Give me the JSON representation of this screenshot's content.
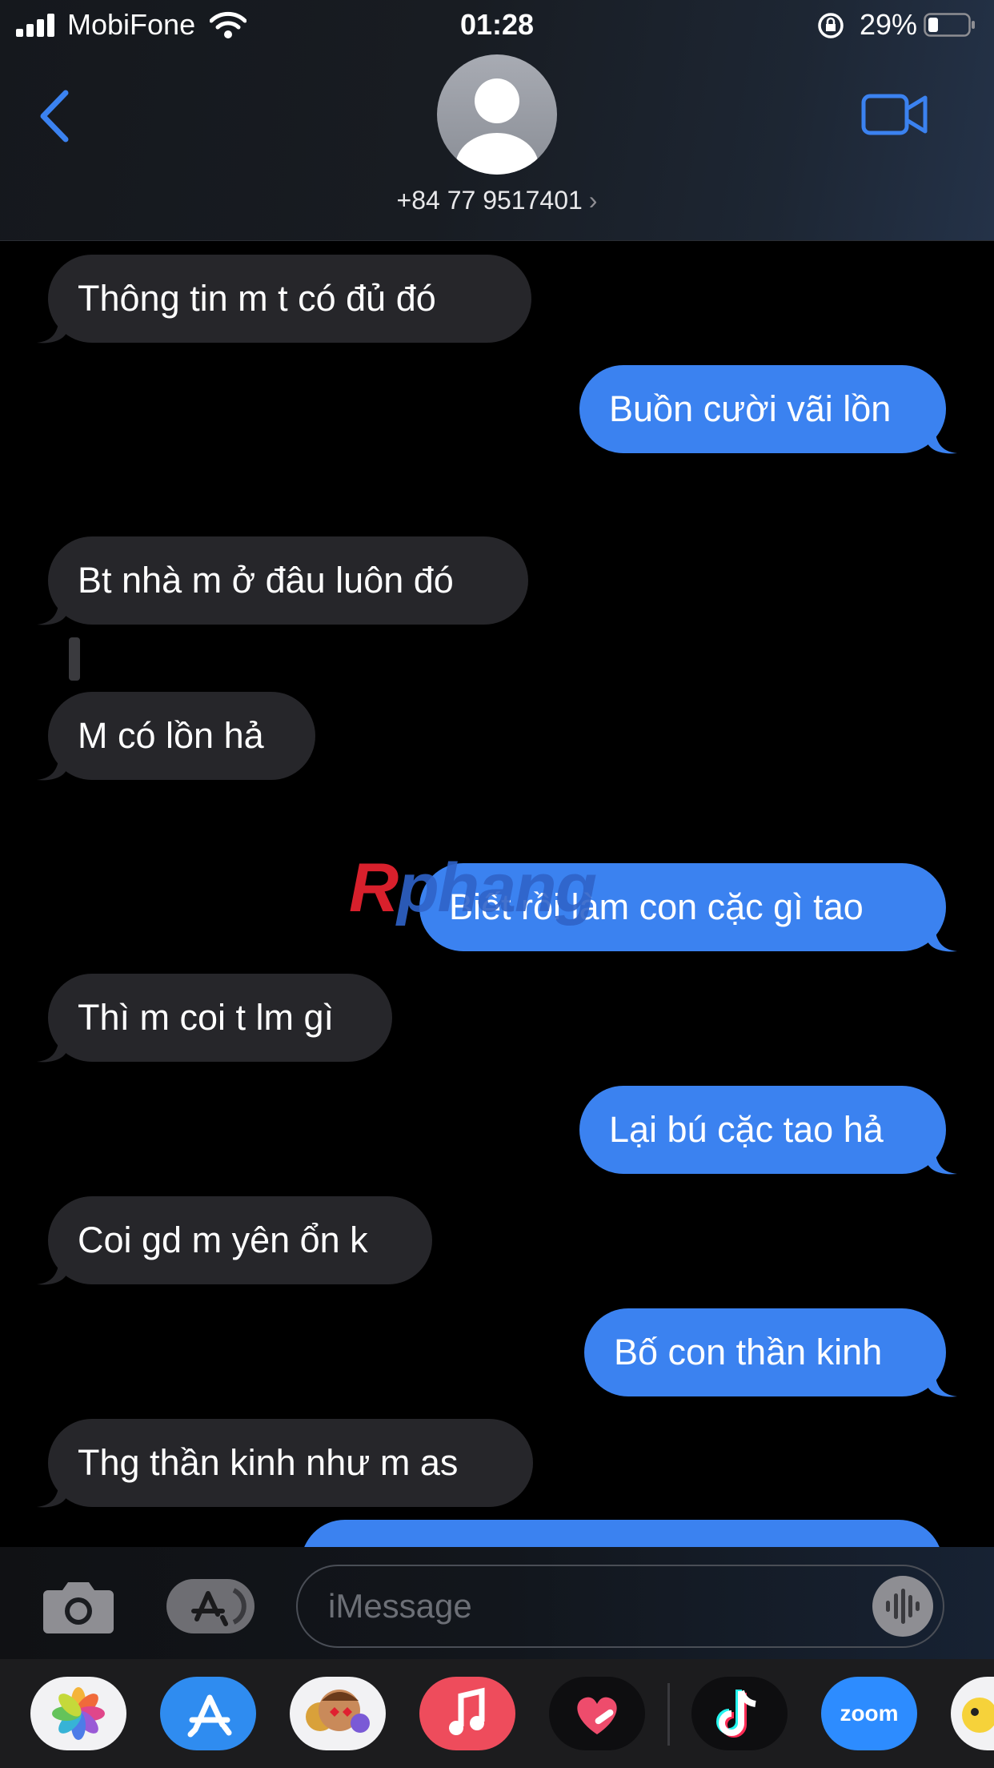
{
  "status_bar": {
    "carrier": "MobiFone",
    "time": "01:28",
    "battery_percent": "29%"
  },
  "header": {
    "contact": "+84 77 9517401",
    "contact_chevron": "›",
    "back_icon": "chevron-left-icon",
    "video_icon": "video-camera-icon"
  },
  "messages": [
    {
      "side": "in",
      "text": "Thông tin m t có đủ đó"
    },
    {
      "side": "out",
      "text": "Buồn cười vãi lồn"
    },
    {
      "side": "in",
      "text": "Bt nhà m ở đâu luôn đó"
    },
    {
      "side": "in",
      "text": "M có lồn hả"
    },
    {
      "side": "out",
      "text": "Biết rồi làm con cặc gì tao"
    },
    {
      "side": "in",
      "text": "Thì m coi t lm gì"
    },
    {
      "side": "out",
      "text": "Lại bú cặc tao hả"
    },
    {
      "side": "in",
      "text": "Coi gd m yên ổn k"
    },
    {
      "side": "out",
      "text": "Bố con thần kinh"
    },
    {
      "side": "in",
      "text": "Thg thần kinh như m as"
    }
  ],
  "watermark": {
    "text_red": "R",
    "text_blue": "phang"
  },
  "composer": {
    "placeholder": "iMessage"
  },
  "colors": {
    "outgoing": "#3b82f0",
    "incoming": "#26262a",
    "accent": "#3b82f0"
  },
  "app_drawer": [
    "photos-app-icon",
    "app-store-icon",
    "memoji-icon",
    "music-icon",
    "heart-app-icon",
    "tiktok-icon",
    "zoom-icon",
    "sticker-icon"
  ],
  "app_labels": {
    "zoom": "zoom"
  }
}
